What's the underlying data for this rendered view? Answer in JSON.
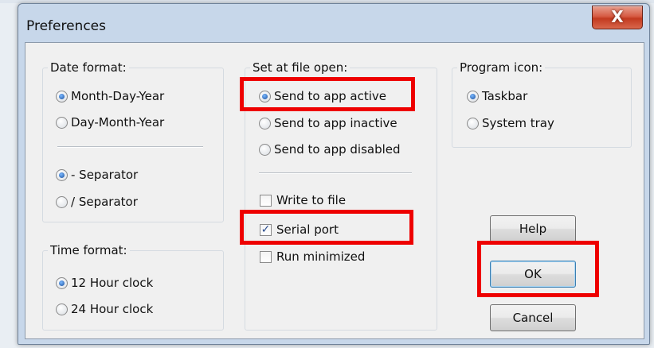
{
  "window": {
    "title": "Preferences",
    "close_label": "X"
  },
  "date_format": {
    "legend": "Date format:",
    "options": [
      "Month-Day-Year",
      "Day-Month-Year"
    ],
    "selected": "Month-Day-Year",
    "separators": [
      "- Separator",
      "/ Separator"
    ],
    "selected_separator": "- Separator"
  },
  "time_format": {
    "legend": "Time format:",
    "options": [
      "12 Hour clock",
      "24 Hour clock"
    ],
    "selected": "12 Hour clock"
  },
  "file_open": {
    "legend": "Set at file open:",
    "options": [
      "Send to app active",
      "Send to app inactive",
      "Send to app disabled"
    ],
    "selected": "Send to app active",
    "checkboxes": [
      {
        "label": "Write to file",
        "checked": false
      },
      {
        "label": "Serial port",
        "checked": true
      },
      {
        "label": "Run minimized",
        "checked": false
      }
    ]
  },
  "program_icon": {
    "legend": "Program icon:",
    "options": [
      "Taskbar",
      "System tray"
    ],
    "selected": "Taskbar"
  },
  "buttons": {
    "help": "Help",
    "ok": "OK",
    "cancel": "Cancel"
  },
  "highlight_color": "#ee0000"
}
